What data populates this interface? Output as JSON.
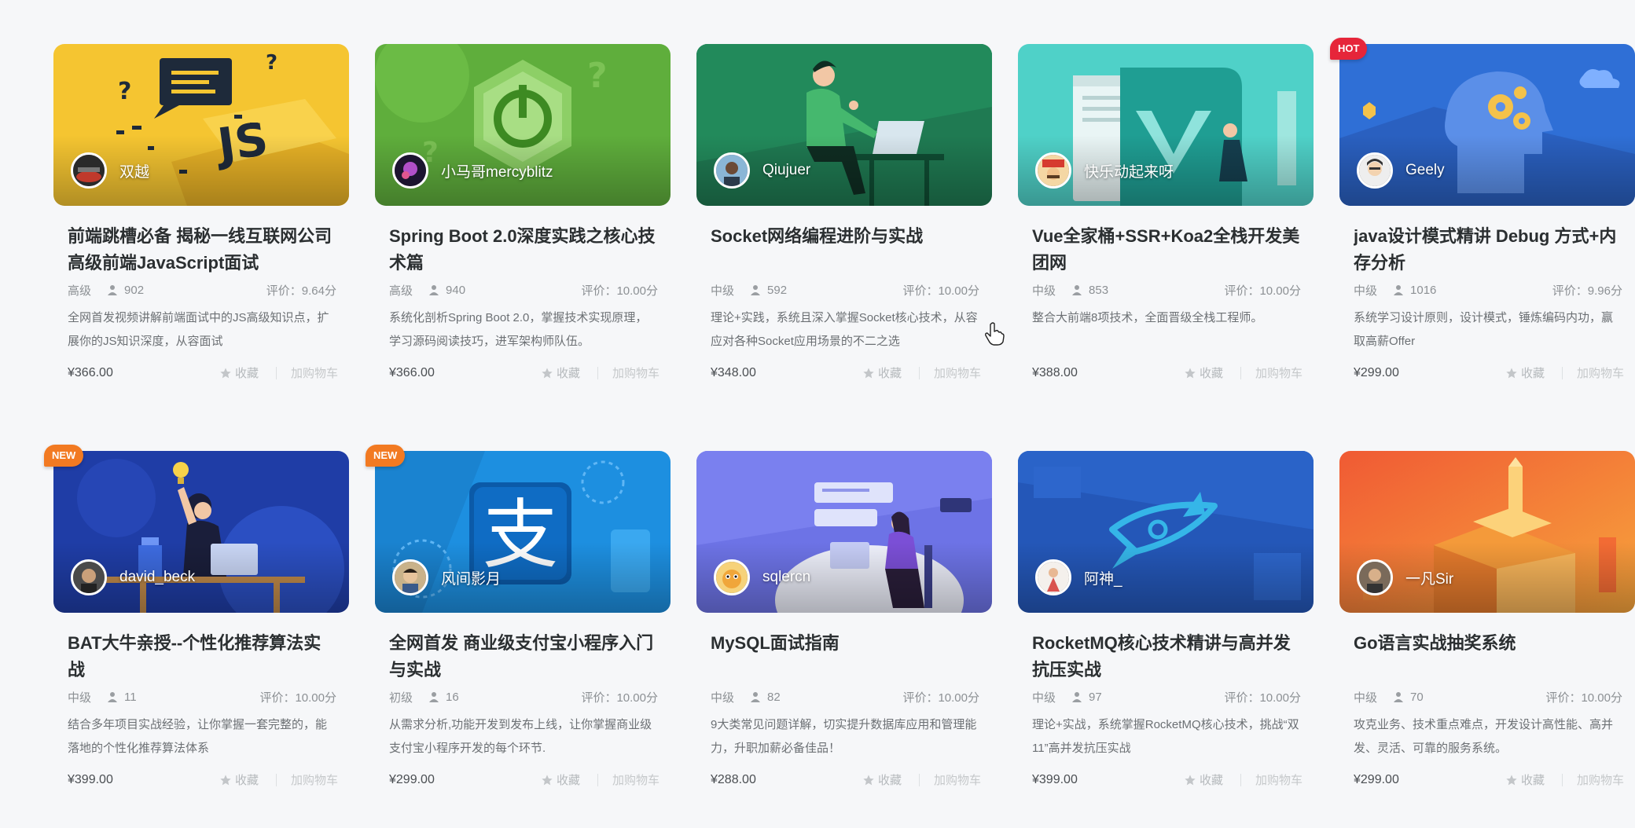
{
  "courses": [
    {
      "author": "双越",
      "title": "前端跳槽必备 揭秘一线互联网公司高级前端JavaScript面试",
      "level": "高级",
      "students": "902",
      "rating": "评价：9.64分",
      "description": "全网首发视频讲解前端面试中的JS高级知识点，扩展你的JS知识深度，从容面试",
      "price": "¥366.00",
      "badge": ""
    },
    {
      "author": "小马哥mercyblitz",
      "title": "Spring Boot 2.0深度实践之核心技术篇",
      "level": "高级",
      "students": "940",
      "rating": "评价：10.00分",
      "description": "系统化剖析Spring Boot 2.0，掌握技术实现原理，学习源码阅读技巧，进军架构师队伍。",
      "price": "¥366.00",
      "badge": ""
    },
    {
      "author": "Qiujuer",
      "title": "Socket网络编程进阶与实战",
      "level": "中级",
      "students": "592",
      "rating": "评价：10.00分",
      "description": "理论+实践，系统且深入掌握Socket核心技术，从容应对各种Socket应用场景的不二之选",
      "price": "¥348.00",
      "badge": ""
    },
    {
      "author": "快乐动起来呀",
      "title": "Vue全家桶+SSR+Koa2全栈开发美团网",
      "level": "中级",
      "students": "853",
      "rating": "评价：10.00分",
      "description": "整合大前端8项技术，全面晋级全栈工程师。",
      "price": "¥388.00",
      "badge": ""
    },
    {
      "author": "Geely",
      "title": "java设计模式精讲 Debug 方式+内存分析",
      "level": "中级",
      "students": "1016",
      "rating": "评价：9.96分",
      "description": "系统学习设计原则，设计模式，锤炼编码内功，赢取高薪Offer",
      "price": "¥299.00",
      "badge": "HOT"
    },
    {
      "author": "david_beck",
      "title": "BAT大牛亲授--个性化推荐算法实战",
      "level": "中级",
      "students": "11",
      "rating": "评价：10.00分",
      "description": "结合多年项目实战经验，让你掌握一套完整的，能落地的个性化推荐算法体系",
      "price": "¥399.00",
      "badge": "NEW"
    },
    {
      "author": "风间影月",
      "title": "全网首发 商业级支付宝小程序入门与实战",
      "level": "初级",
      "students": "16",
      "rating": "评价：10.00分",
      "description": "从需求分析,功能开发到发布上线，让你掌握商业级支付宝小程序开发的每个环节.",
      "price": "¥299.00",
      "badge": "NEW"
    },
    {
      "author": "sqlercn",
      "title": "MySQL面试指南",
      "level": "中级",
      "students": "82",
      "rating": "评价：10.00分",
      "description": "9大类常见问题详解，切实提升数据库应用和管理能力，升职加薪必备佳品！",
      "price": "¥288.00",
      "badge": ""
    },
    {
      "author": "阿神_",
      "title": "RocketMQ核心技术精讲与高并发抗压实战",
      "level": "中级",
      "students": "97",
      "rating": "评价：10.00分",
      "description": "理论+实战，系统掌握RocketMQ核心技术，挑战“双11”高并发抗压实战",
      "price": "¥399.00",
      "badge": ""
    },
    {
      "author": "一凡Sir",
      "title": "Go语言实战抽奖系统",
      "level": "中级",
      "students": "70",
      "rating": "评价：10.00分",
      "description": "攻克业务、技术重点难点，开发设计高性能、高并发、灵活、可靠的服务系统。",
      "price": "¥299.00",
      "badge": ""
    }
  ],
  "labels": {
    "favorite": "收藏",
    "cart": "加购物车"
  },
  "colors": {
    "badge_new": "#f27a22",
    "badge_hot": "#e6253a"
  }
}
